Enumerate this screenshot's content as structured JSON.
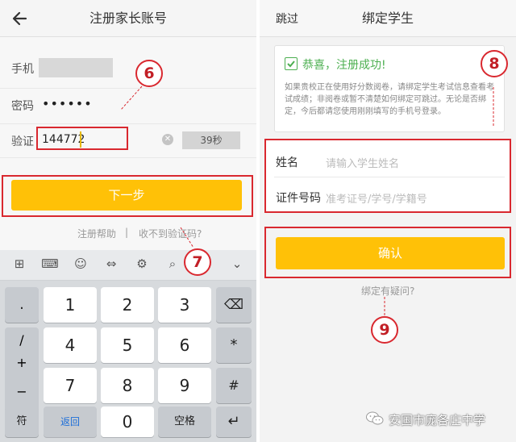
{
  "left": {
    "title": "注册家长账号",
    "back_icon": "arrow-left-icon",
    "phone_label": "手机",
    "password_label": "密码",
    "password_value": "••••••",
    "verify_label": "验证",
    "verify_value": "144772",
    "countdown": "39秒",
    "next_button": "下一步",
    "help_link": "注册帮助",
    "separator": "|",
    "no_code_link": "收不到验证码?",
    "callout_6": "6",
    "callout_7": "7",
    "keyboard": {
      "toolbar_icons": [
        "grid-icon",
        "keyboard-icon",
        "emoji-icon",
        "cursor-icon",
        "settings-icon",
        "search-icon",
        "chevron-down-icon"
      ],
      "left_keys": [
        ".",
        "/",
        "+",
        "−",
        "符"
      ],
      "digits": [
        "1",
        "2",
        "3",
        "4",
        "5",
        "6",
        "7",
        "8",
        "9",
        "0"
      ],
      "right_keys": [
        "⌫",
        "*",
        "#"
      ],
      "back_key": "返回",
      "space_key": "空格",
      "enter_key": "↵"
    }
  },
  "right": {
    "skip": "跳过",
    "title": "绑定学生",
    "success_text": "恭喜，注册成功!",
    "info_text": "如果贵校正在使用好分数阅卷，请绑定学生考试信息查看考试成绩；非阅卷或暂不清楚如何绑定可跳过。无论是否绑定，今后都请您使用刚刚填写的手机号登录。",
    "name_label": "姓名",
    "name_placeholder": "请输入学生姓名",
    "id_label": "证件号码",
    "id_placeholder": "准考证号/学号/学籍号",
    "confirm_button": "确认",
    "question_link": "绑定有疑问?",
    "callout_8": "8",
    "callout_9": "9"
  },
  "watermark": "安国市庞各庄中学",
  "colors": {
    "accent": "#ffc107",
    "callout_red": "#d9282f",
    "success_green": "#4caf50"
  }
}
